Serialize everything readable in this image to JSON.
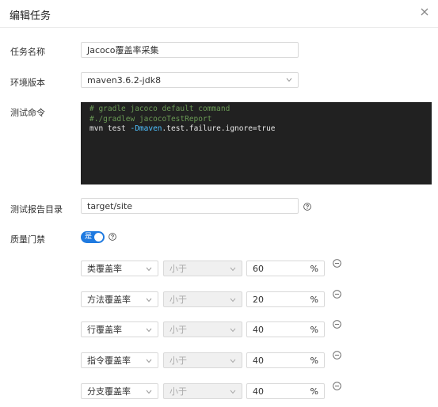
{
  "dialog": {
    "title": "编辑任务"
  },
  "form": {
    "task_name": {
      "label": "任务名称",
      "value": "Jacoco覆盖率采集"
    },
    "env_version": {
      "label": "环境版本",
      "value": "maven3.6.2-jdk8"
    },
    "test_command": {
      "label": "测试命令",
      "lines": [
        "# gradle jacoco default command",
        "#./gradlew jacocoTestReport",
        "mvn test -Dmaven.test.failure.ignore=true"
      ],
      "line3_parts": [
        "mvn test ",
        "-Dmaven",
        ".test.failure.ignore=true"
      ]
    },
    "report_dir": {
      "label": "测试报告目录",
      "value": "target/site"
    },
    "quality_gate": {
      "label": "质量门禁",
      "toggle_text": "是",
      "enabled": true
    }
  },
  "rules": [
    {
      "metric": "类覆盖率",
      "operator": "小于",
      "value": "60",
      "unit": "%"
    },
    {
      "metric": "方法覆盖率",
      "operator": "小于",
      "value": "20",
      "unit": "%"
    },
    {
      "metric": "行覆盖率",
      "operator": "小于",
      "value": "40",
      "unit": "%"
    },
    {
      "metric": "指令覆盖率",
      "operator": "小于",
      "value": "40",
      "unit": "%"
    },
    {
      "metric": "分支覆盖率",
      "operator": "小于",
      "value": "40",
      "unit": "%"
    }
  ],
  "colors": {
    "accent": "#1f7ae0",
    "code_bg": "#212121",
    "comment": "#6a9955",
    "flag": "#4fc1ff"
  }
}
